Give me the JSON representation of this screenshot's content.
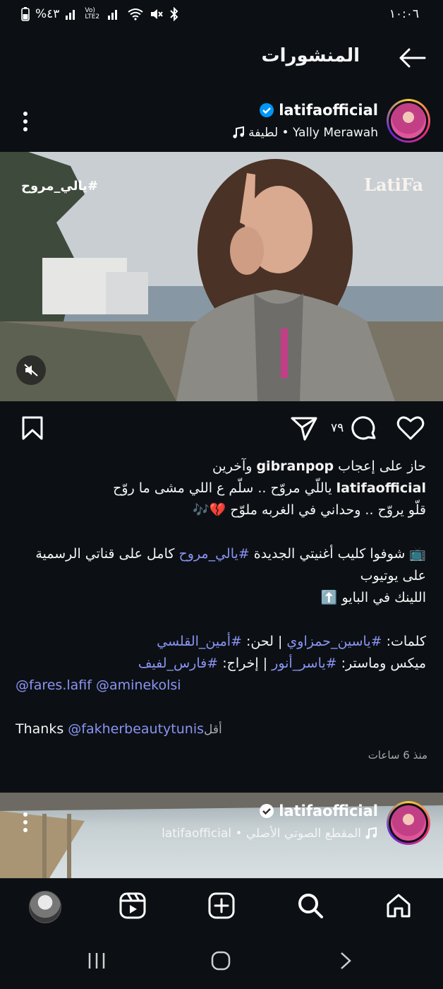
{
  "status_bar": {
    "time": "١٠:٠٦",
    "battery": "%٤٣",
    "lte": "Vo) LTE2"
  },
  "header": {
    "title": "المنشورات"
  },
  "post1": {
    "username": "latifaofficial",
    "audio_text": "Yally Merawah • لطيفة",
    "image_hashtag": "#يالي_مروح",
    "image_brand": "LatiFa",
    "comment_count": "٧٩",
    "liked_by_prefix": "حاز على إعجاب ",
    "liked_by_user": "gibranpop",
    "liked_by_suffix": " وآخرين",
    "caption_user": "latifaofficial",
    "caption_line1": " ياللّي مروّح .. سلّم ع اللي مشى ما روّح",
    "caption_line2": "قلّو يروّح .. وحداني في الغربه ملوّح 💔🎶",
    "caption_line3_pre": "📺 شوفوا كليب أغنيتي الجديدة ",
    "caption_line3_tag": "#يالي_مروح",
    "caption_line3_post": " كامل على قناتي الرسمية",
    "caption_line4": "على يوتيوب",
    "caption_line5": "اللينك في البايو ⬆️",
    "caption_line6_pre": "كلمات: ",
    "caption_line6_tag1": "#ياسين_حمزاوي",
    "caption_line6_mid": " | لحن: ",
    "caption_line6_tag2": "#أمين_القلسي",
    "caption_line7_pre": "ميكس وماستر: ",
    "caption_line7_tag1": "#ياسر_أنور",
    "caption_line7_mid": " | إخراج: ",
    "caption_line7_tag2": "#فارس_لفيف",
    "caption_mention1": "@fares.lafif",
    "caption_mention2": "@aminekolsi",
    "caption_thanks": "Thanks ",
    "caption_thanks_mention": "@fakherbeautytunis",
    "less_label": "أقل",
    "time_ago": "منذ 6 ساعات"
  },
  "post2": {
    "username": "latifaofficial",
    "audio_text": "المقطع الصوتي الأصلي • latifaofficial"
  },
  "colors": {
    "background": "#0c1014",
    "link": "#8a94f3",
    "verified": "#0095f6"
  },
  "icons": [
    "back-arrow-icon",
    "verified-icon",
    "music-note-icon",
    "more-icon",
    "mute-icon",
    "like-icon",
    "comment-icon",
    "share-icon",
    "save-icon",
    "home-icon",
    "search-icon",
    "create-icon",
    "reels-icon",
    "profile-avatar",
    "recents-icon",
    "home-circle-icon",
    "chevron-back-icon"
  ]
}
